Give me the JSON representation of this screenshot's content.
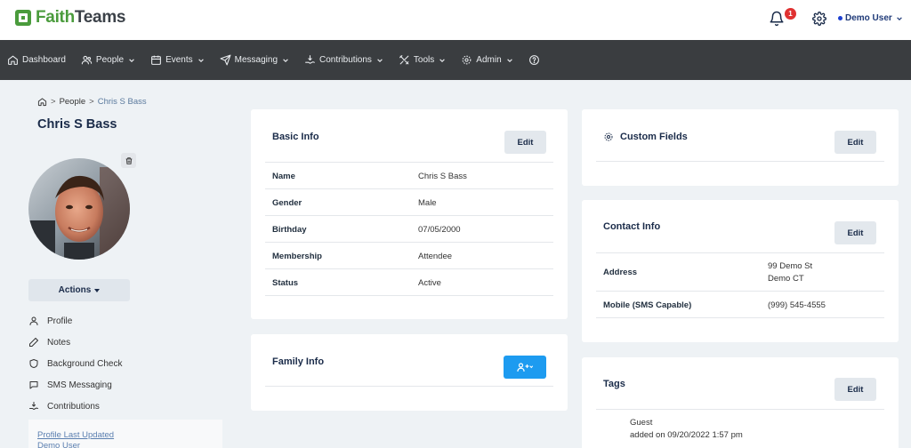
{
  "app": {
    "brand_part1": "Faith",
    "brand_part2": "Teams",
    "notification_count": "1",
    "user_name": "Demo User",
    "accent_green": "#4a9b3c",
    "nav_bg": "#3a3d40"
  },
  "nav": {
    "items": [
      {
        "label": "Dashboard",
        "icon": "home-icon",
        "has_dropdown": false
      },
      {
        "label": "People",
        "icon": "people-icon",
        "has_dropdown": true
      },
      {
        "label": "Events",
        "icon": "calendar-icon",
        "has_dropdown": true
      },
      {
        "label": "Messaging",
        "icon": "send-icon",
        "has_dropdown": true
      },
      {
        "label": "Contributions",
        "icon": "hand-coins-icon",
        "has_dropdown": true
      },
      {
        "label": "Tools",
        "icon": "tools-icon",
        "has_dropdown": true
      },
      {
        "label": "Admin",
        "icon": "gear-icon",
        "has_dropdown": true
      },
      {
        "label": "",
        "icon": "help-icon",
        "has_dropdown": false
      }
    ]
  },
  "breadcrumb": {
    "sep": ">",
    "people": "People",
    "current": "Chris S Bass"
  },
  "person": {
    "name": "Chris S Bass",
    "actions_label": "Actions"
  },
  "side_menu": [
    {
      "label": "Profile",
      "icon": "user-icon"
    },
    {
      "label": "Notes",
      "icon": "pencil-icon"
    },
    {
      "label": "Background Check",
      "icon": "shield-icon"
    },
    {
      "label": "SMS Messaging",
      "icon": "chat-icon"
    },
    {
      "label": "Contributions",
      "icon": "hand-coins-icon"
    }
  ],
  "profile_updated": {
    "label": "Profile Last Updated",
    "by": "Demo User"
  },
  "basic_info": {
    "title": "Basic Info",
    "edit_label": "Edit",
    "rows": [
      {
        "label": "Name",
        "value": "Chris S Bass"
      },
      {
        "label": "Gender",
        "value": "Male"
      },
      {
        "label": "Birthday",
        "value": "07/05/2000"
      },
      {
        "label": "Membership",
        "value": "Attendee"
      },
      {
        "label": "Status",
        "value": "Active"
      }
    ]
  },
  "family_info": {
    "title": "Family Info"
  },
  "custom_fields": {
    "title": "Custom Fields",
    "edit_label": "Edit"
  },
  "contact_info": {
    "title": "Contact Info",
    "edit_label": "Edit",
    "address_label": "Address",
    "address_line1": "99 Demo St",
    "address_line2": "Demo CT",
    "mobile_label": "Mobile (SMS Capable)",
    "mobile_value": "(999) 545-4555"
  },
  "tags": {
    "title": "Tags",
    "edit_label": "Edit",
    "items": [
      {
        "name": "Guest",
        "added": "added on 09/20/2022 1:57 pm"
      }
    ]
  }
}
